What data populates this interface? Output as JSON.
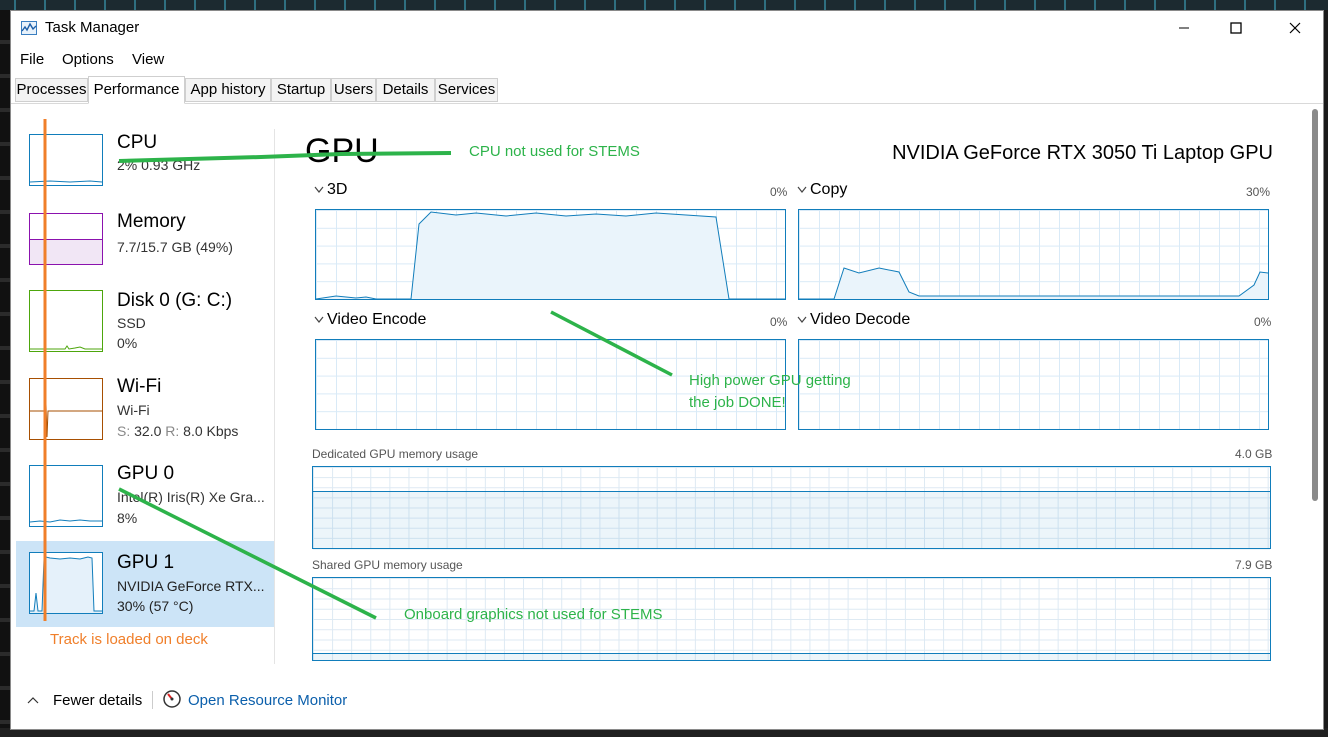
{
  "window": {
    "title": "Task Manager"
  },
  "menu": {
    "file": "File",
    "options": "Options",
    "view": "View"
  },
  "tabs": [
    "Processes",
    "Performance",
    "App history",
    "Startup",
    "Users",
    "Details",
    "Services"
  ],
  "active_tab": "Performance",
  "sidebar": {
    "items": [
      {
        "name": "CPU",
        "line1": "2%  0.93 GHz",
        "line2": ""
      },
      {
        "name": "Memory",
        "line1": "7.7/15.7 GB (49%)",
        "line2": ""
      },
      {
        "name": "Disk 0 (G: C:)",
        "line1": "SSD",
        "line2": "0%"
      },
      {
        "name": "Wi-Fi",
        "line1": "Wi-Fi",
        "line2_s": "S:",
        "line2_sv": "32.0",
        "line2_r": "R:",
        "line2_rv": "8.0 Kbps"
      },
      {
        "name": "GPU 0",
        "line1": "Intel(R) Iris(R) Xe Gra...",
        "line2": "8%"
      },
      {
        "name": "GPU 1",
        "line1": "NVIDIA GeForce RTX...",
        "line2": "30%  (57 °C)"
      }
    ]
  },
  "main": {
    "title": "GPU",
    "model": "NVIDIA GeForce RTX 3050 Ti Laptop GPU",
    "engines": [
      {
        "label": "3D",
        "pct": "0%"
      },
      {
        "label": "Copy",
        "pct": "30%"
      },
      {
        "label": "Video Encode",
        "pct": "0%"
      },
      {
        "label": "Video Decode",
        "pct": "0%"
      }
    ],
    "dedicated": {
      "label": "Dedicated GPU memory usage",
      "max": "4.0 GB"
    },
    "shared": {
      "label": "Shared GPU memory usage",
      "max": "7.9 GB"
    }
  },
  "footer": {
    "fewer_details": "Fewer details",
    "resource_monitor": "Open Resource Monitor"
  },
  "annotations": {
    "cpu": "CPU not used for STEMS",
    "gpu_high_1": "High power GPU getting",
    "gpu_high_2": "the job DONE!",
    "onboard": "Onboard graphics not used for STEMS",
    "track": "Track is loaded on deck"
  },
  "colors": {
    "gpu_line": "#117dbb",
    "memory_line": "#8b12ae",
    "disk_line": "#4da60c",
    "wifi_line": "#a74f01",
    "annotation_green": "#2db34a",
    "annotation_orange": "#f07f2a",
    "selected_bg": "#cce4f7"
  }
}
